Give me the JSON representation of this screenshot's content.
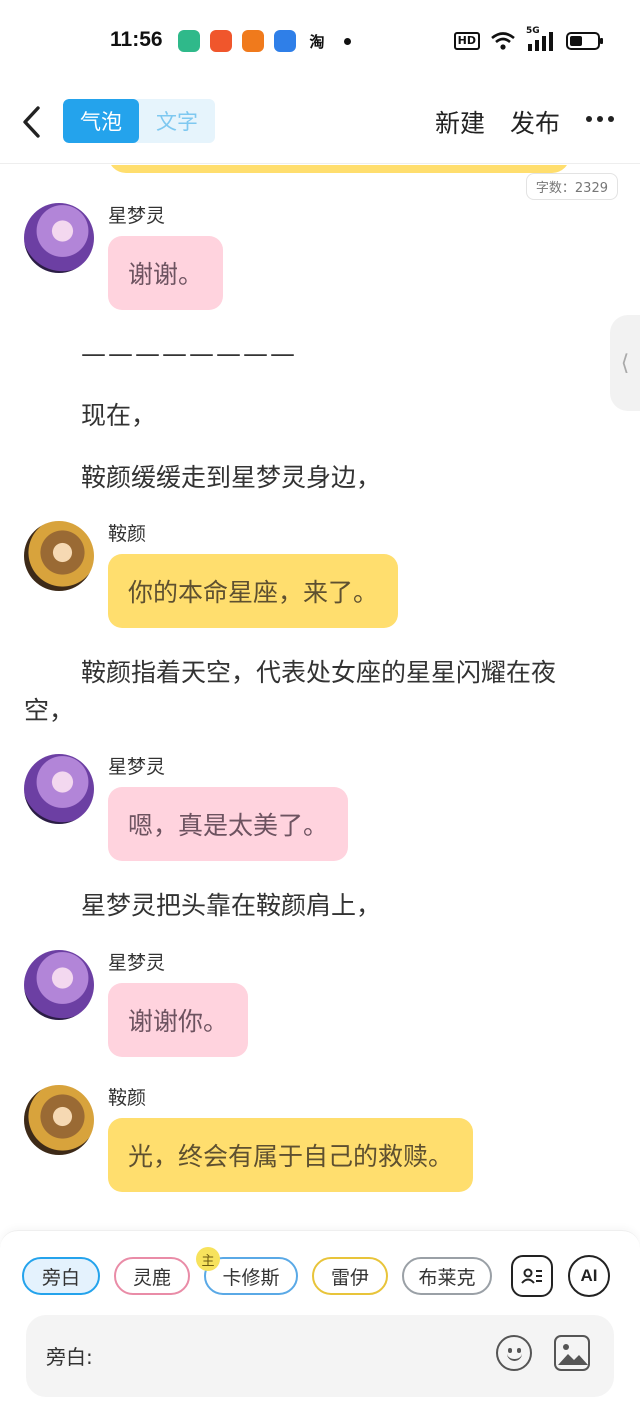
{
  "status_bar": {
    "time": "11:56",
    "app_icons": [
      "fingerprint-app",
      "meituan-app",
      "taobao-app",
      "browser-app",
      "tao-app"
    ],
    "tao_label": "淘",
    "hd_label": "HD",
    "network": "5G",
    "battery_level": 0.45
  },
  "header": {
    "tab_bubble": "气泡",
    "tab_text": "文字",
    "new_label": "新建",
    "publish_label": "发布"
  },
  "word_count": "字数：2329",
  "side_tab_glyph": "⟨",
  "messages": [
    {
      "type": "bubble",
      "speaker": "星梦灵",
      "text": "谢谢。",
      "color": "pink"
    },
    {
      "type": "narration",
      "text": "————————"
    },
    {
      "type": "narration",
      "text": "现在，"
    },
    {
      "type": "narration",
      "text": "鞍颜缓缓走到星梦灵身边，"
    },
    {
      "type": "bubble",
      "speaker": "鞍颜",
      "text": "你的本命星座，来了。",
      "color": "yellow"
    },
    {
      "type": "narration",
      "text": "鞍颜指着天空，代表处女座的星星闪耀在夜空，"
    },
    {
      "type": "bubble",
      "speaker": "星梦灵",
      "text": "嗯，真是太美了。",
      "color": "pink"
    },
    {
      "type": "narration",
      "text": "星梦灵把头靠在鞍颜肩上，"
    },
    {
      "type": "bubble",
      "speaker": "星梦灵",
      "text": "谢谢你。",
      "color": "pink"
    },
    {
      "type": "bubble",
      "speaker": "鞍颜",
      "text": "光，终会有属于自己的救赎。",
      "color": "yellow"
    }
  ],
  "characters": [
    {
      "label": "旁白",
      "color": "#24a3ec",
      "selected": true
    },
    {
      "label": "灵鹿",
      "color": "#e98ca7",
      "selected": false
    },
    {
      "label": "卡修斯",
      "color": "#5aa9e6",
      "selected": false
    },
    {
      "label": "雷伊",
      "color": "#e8c43a",
      "selected": false
    },
    {
      "label": "布莱克",
      "color": "#9aa0a6",
      "selected": false
    }
  ],
  "main_badge": "主",
  "ai_label": "AI",
  "input": {
    "label": "旁白:"
  },
  "colors": {
    "accent": "#24a3ec",
    "bubble_pink": "#ffd3de",
    "bubble_yellow": "#ffde6e"
  }
}
